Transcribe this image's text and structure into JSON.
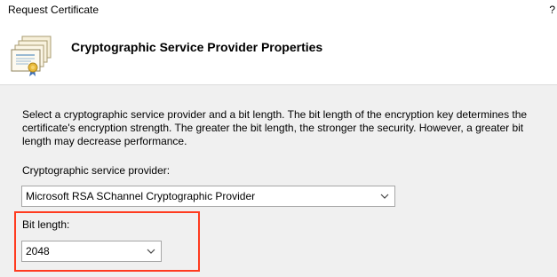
{
  "window": {
    "title": "Request Certificate",
    "help": "?"
  },
  "header": {
    "title": "Cryptographic Service Provider Properties",
    "icon": "certificate-icon"
  },
  "content": {
    "description": "Select a cryptographic service provider and a bit length. The bit length of the encryption key determines the certificate's encryption strength. The greater the bit length, the stronger the security. However, a greater bit length may decrease performance.",
    "csp": {
      "label": "Cryptographic service provider:",
      "selected": "Microsoft RSA SChannel Cryptographic Provider"
    },
    "bit_length": {
      "label": "Bit length:",
      "selected": "2048"
    }
  },
  "colors": {
    "highlight": "#ff3b1f",
    "content_bg": "#f0f0f0"
  }
}
